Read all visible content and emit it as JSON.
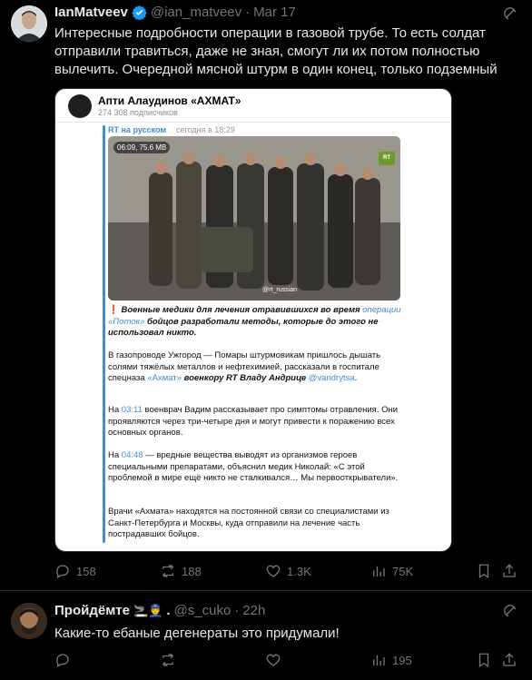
{
  "tweet1": {
    "name": "IanMatveev",
    "handle": "@ian_matveev",
    "sep": "·",
    "date": "Mar 17",
    "text": "Интересные подробности операции в газовой трубе. То есть солдат отправили травиться, даже не зная, смогут ли их потом полностью вылечить. Очередной мясной штурм в один конец, только подземный",
    "embed": {
      "channel_name": "Апти Алаудинов «АХМАТ»",
      "subscribers": "274 308 подписчиков",
      "forward_source": "RT на русском",
      "forward_time": "сегодня в 18:29",
      "video_badge": "06:09, 75.6 MB",
      "rt_logo": "RT",
      "watermark": "@rt_russian",
      "p1_excl": "❗",
      "p1_a": " Военные медики для лечения отравившихся во время ",
      "p1_link": "операции «Поток»",
      "p1_b": " бойцов разработали методы, которые до этого не использовал никто.",
      "p2_a": "В газопроводе Ужгород — Помары штурмовикам пришлось дышать солями тяжёлых металлов и нефтехимией, рассказали в госпитале спецназа ",
      "p2_link": "«Ахмат»",
      "p2_b": " военкору RT Владу Андрице",
      "p2_link2": "@vandrytsa",
      "p2_c": ".",
      "p3_a": "На ",
      "p3_link": "03:11",
      "p3_b": " военврач Вадим рассказывает про симптомы отравления. Они проявляются через три-четыре дня и могут привести к поражению всех основных органов.",
      "p4_a": "На ",
      "p4_link": "04:48",
      "p4_b": " — вредные вещества выводят из организмов героев специальными препаратами, объяснил медик Николай: «С этой проблемой в мире ещё никто не сталкивался… Мы первооткрыватели».",
      "p5": "Врачи «Ахмата» находятся на постоянной связи со специалистами из Санкт-Петербурга и Москвы, куда отправили на лечение часть пострадавших бойцов."
    },
    "stats": {
      "replies": "158",
      "reposts": "188",
      "likes": "1.3K",
      "views": "75K"
    }
  },
  "tweet2": {
    "name": "Пройдёмте",
    "name_emojis": "🚬👮",
    "name_dot": ".",
    "handle": "@s_cuko",
    "sep": "·",
    "date": "22h",
    "text": "Какие-то ебаные дегенераты это придумали!",
    "stats": {
      "replies": "",
      "reposts": "",
      "likes": "",
      "views": "195"
    }
  },
  "icons": [
    "verified-badge-icon",
    "grok-icon",
    "reply-icon",
    "repost-icon",
    "like-icon",
    "views-icon",
    "bookmark-icon",
    "share-icon"
  ],
  "colors": {
    "background": "#000000",
    "text": "#e7e9ea",
    "muted": "#71767b",
    "verified": "#1d9bf0",
    "link": "#3f8ed6"
  }
}
